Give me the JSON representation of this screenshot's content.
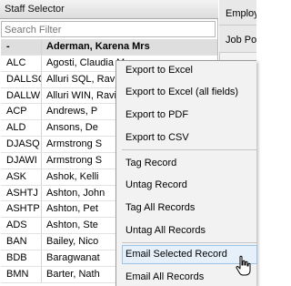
{
  "staff_selector": {
    "title": "Staff Selector",
    "search_placeholder": "Search Filter",
    "rows": [
      {
        "code": "-",
        "name": "Aderman, Karena Mrs",
        "header": true
      },
      {
        "code": "ALC",
        "name": "Agosti, Claudia M"
      },
      {
        "code": "DALLSQ",
        "name": "Alluri SQL, Ravi"
      },
      {
        "code": "DALLWI",
        "name": "Alluri WIN, Ravi"
      },
      {
        "code": "ACP",
        "name": "Andrews, P"
      },
      {
        "code": "ALD",
        "name": "Ansons, De"
      },
      {
        "code": "DJASQ",
        "name": "Armstrong S"
      },
      {
        "code": "DJAWI",
        "name": "Armstrong S"
      },
      {
        "code": "ASK",
        "name": "Ashok, Kelli"
      },
      {
        "code": "ASHTJ",
        "name": "Ashton, John"
      },
      {
        "code": "ASHTP",
        "name": "Ashton, Pet"
      },
      {
        "code": "ADS",
        "name": "Ashton, Ste"
      },
      {
        "code": "BAN",
        "name": "Bailey, Nico"
      },
      {
        "code": "BDB",
        "name": "Baragwanat"
      },
      {
        "code": "BMN",
        "name": "Barter, Nath"
      }
    ]
  },
  "right_panel": {
    "field1": "Employ",
    "field2": "Job Po"
  },
  "context_menu": {
    "items": [
      {
        "label": "Export to Excel"
      },
      {
        "label": "Export to Excel (all fields)"
      },
      {
        "label": "Export to PDF"
      },
      {
        "label": "Export to CSV"
      },
      {
        "label": "Tag Record"
      },
      {
        "label": "Untag Record"
      },
      {
        "label": "Tag All Records"
      },
      {
        "label": "Untag All Records"
      },
      {
        "label": "Email Selected Record"
      },
      {
        "label": "Email All Records"
      }
    ],
    "hovered": "Email Selected Record"
  },
  "icons": {
    "cursor": "hand-pointer-icon"
  }
}
